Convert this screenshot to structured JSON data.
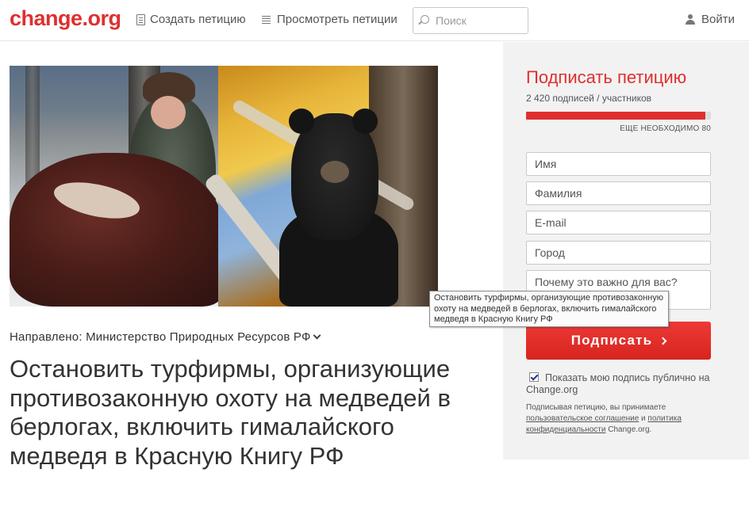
{
  "header": {
    "logo": "change.org",
    "nav_create": "Создать петицию",
    "nav_browse": "Просмотреть петиции",
    "search_placeholder": "Поиск",
    "login": "Войти"
  },
  "tooltip": {
    "text": "Остановить турфирмы, организующие противозаконную охоту на медведей в берлогах, включить гималайского медведя в Красную Книгу РФ"
  },
  "petition": {
    "addressed_label": "Направлено:",
    "addressed_to": "Министерство Природных Ресурсов РФ",
    "title": "Остановить турфирмы, организующие противозаконную охоту на медведей в берлогах, включить гималайского медведя в Красную Книгу РФ"
  },
  "sidebar": {
    "title": "Подписать петицию",
    "count": "2 420 подписей / участников",
    "progress": 0.968,
    "needed": "ЕЩЕ НЕОБХОДИМО 80",
    "fields": {
      "first_name": "Имя",
      "last_name": "Фамилия",
      "email": "E-mail",
      "city": "Город",
      "reason": "Почему это важно для вас?"
    },
    "sign_button": "Подписать",
    "public_checkbox": "Показать мою подпись публично на Change.org",
    "terms_prefix": "Подписывая петицию, вы принимаете",
    "terms_link1": "пользовательское соглашение",
    "terms_and": "и",
    "terms_link2": "политика конфиденциальности",
    "terms_suffix": "Change.org."
  },
  "colors": {
    "brand": "#e02f2f",
    "sidebar_bg": "#f2f2f2"
  }
}
